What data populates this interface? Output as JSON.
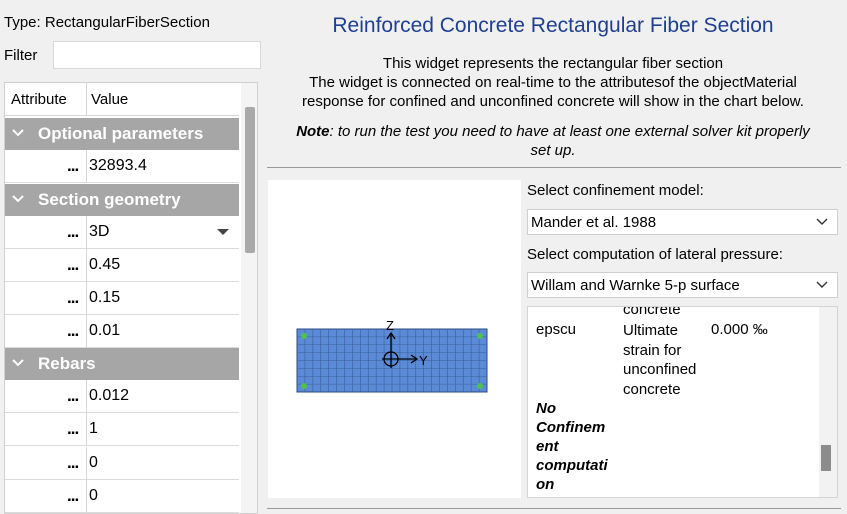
{
  "left_panel": {
    "type_label": "Type:",
    "type_value": "RectangularFiberSection",
    "filter_label": "Filter",
    "filter_value": "",
    "header": {
      "attribute": "Attribute",
      "value": "Value"
    },
    "groups": [
      {
        "label": "Optional parameters",
        "rows": [
          {
            "dots": "...",
            "value": "32893.4"
          }
        ]
      },
      {
        "label": "Section geometry",
        "rows": [
          {
            "dots": "...",
            "value": "3D",
            "dropdown": true
          },
          {
            "dots": "...",
            "value": "0.45"
          },
          {
            "dots": "...",
            "value": "0.15"
          },
          {
            "dots": "...",
            "value": "0.01"
          }
        ]
      },
      {
        "label": "Rebars",
        "rows": [
          {
            "dots": "...",
            "value": "0.012"
          },
          {
            "dots": "...",
            "value": "1"
          },
          {
            "dots": "...",
            "value": "0"
          },
          {
            "dots": "...",
            "value": "0"
          }
        ]
      }
    ]
  },
  "right_panel": {
    "title": "Reinforced Concrete Rectangular Fiber Section",
    "description_lines": [
      "This widget represents the rectangular fiber section",
      "The widget is connected on real-time to the attributesof the objectMaterial",
      "response for confined and unconfined concrete will show in the chart below."
    ],
    "note_bold": "Note",
    "note_line1": ": to run the test you need to have at least one external solver kit properly",
    "note_line2": "set up.",
    "section_axes": {
      "z": "Z",
      "y": "Y"
    },
    "confinement_label": "Select confinement model:",
    "confinement_value": "Mander et al. 1988",
    "lateral_label": "Select computation of lateral pressure:",
    "lateral_value": "Willam and Warnke 5-p surface",
    "info": {
      "partial_text": "concrete",
      "param_name": "epscu",
      "param_desc": [
        "Ultimate",
        "strain for",
        "unconfined",
        "concrete"
      ],
      "param_value": "0.000 ‰",
      "no_confinement": [
        "No",
        "Confinem",
        "ent",
        "computati",
        "on"
      ]
    }
  },
  "colors": {
    "title_blue": "#1f3f8f",
    "group_header_gray": "#a6a6a6",
    "section_fill": "#5b8bd6",
    "rebar_green": "#4ec24e"
  }
}
